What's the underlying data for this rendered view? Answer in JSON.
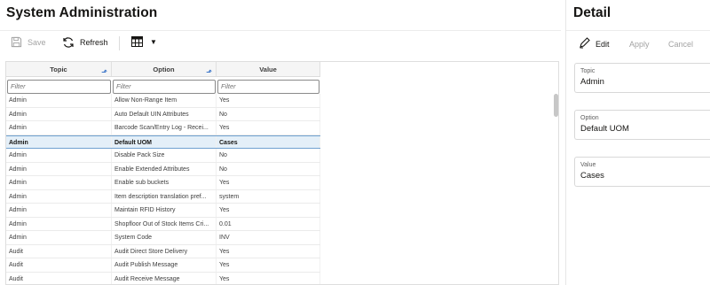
{
  "left_panel": {
    "title": "System Administration",
    "toolbar": {
      "save_label": "Save",
      "refresh_label": "Refresh"
    }
  },
  "table": {
    "columns": [
      "Topic",
      "Option",
      "Value"
    ],
    "filter_placeholder": "Filter",
    "rows": [
      {
        "topic": "Admin",
        "option": "Allow Non-Range Item",
        "value": "Yes"
      },
      {
        "topic": "Admin",
        "option": "Auto Default UIN Attributes",
        "value": "No"
      },
      {
        "topic": "Admin",
        "option": "Barcode Scan/Entry Log - Recei...",
        "value": "Yes"
      },
      {
        "topic": "Admin",
        "option": "Default UOM",
        "value": "Cases"
      },
      {
        "topic": "Admin",
        "option": "Disable Pack Size",
        "value": "No"
      },
      {
        "topic": "Admin",
        "option": "Enable Extended Attributes",
        "value": "No"
      },
      {
        "topic": "Admin",
        "option": "Enable sub buckets",
        "value": "Yes"
      },
      {
        "topic": "Admin",
        "option": "Item description translation pref...",
        "value": "system"
      },
      {
        "topic": "Admin",
        "option": "Maintain RFID History",
        "value": "Yes"
      },
      {
        "topic": "Admin",
        "option": "Shopfloor Out of Stock Items Cri...",
        "value": "0.01"
      },
      {
        "topic": "Admin",
        "option": "System Code",
        "value": "INV"
      },
      {
        "topic": "Audit",
        "option": "Audit Direct Store Delivery",
        "value": "Yes"
      },
      {
        "topic": "Audit",
        "option": "Audit Publish Message",
        "value": "Yes"
      },
      {
        "topic": "Audit",
        "option": "Audit Receive Message",
        "value": "Yes"
      }
    ],
    "selected_row_index": 3
  },
  "right_panel": {
    "title": "Detail",
    "toolbar": {
      "edit_label": "Edit",
      "apply_label": "Apply",
      "cancel_label": "Cancel"
    },
    "fields": {
      "topic": {
        "label": "Topic",
        "value": "Admin"
      },
      "option": {
        "label": "Option",
        "value": "Default UOM"
      },
      "value": {
        "label": "Value",
        "value": "Cases"
      }
    }
  },
  "colors": {
    "selected_row_bg": "#e4eff8",
    "selected_row_border": "#6fa1d0",
    "sort_icon": "#3a74c9",
    "disabled_text": "#a3a3a3"
  },
  "icons": {
    "save": "save-icon",
    "refresh": "refresh-icon",
    "view": "grid-view-icon",
    "sort": "sort-ascending-icon",
    "edit": "pencil-icon"
  }
}
